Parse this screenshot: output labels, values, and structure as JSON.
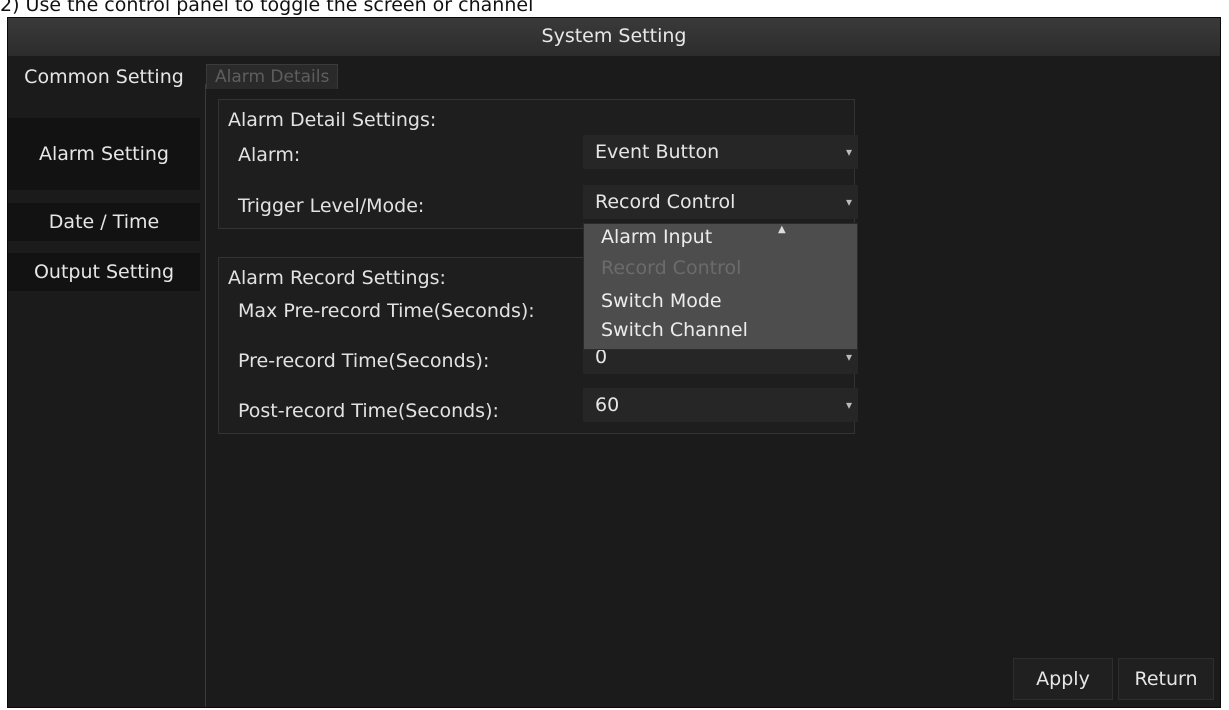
{
  "page_caption": "2) Use the control panel to toggle the screen or channel",
  "window": {
    "title": "System Setting"
  },
  "sidebar": {
    "items": [
      {
        "label": "Common Setting",
        "active": true
      },
      {
        "label": "Alarm Setting"
      },
      {
        "label": "Date / Time"
      },
      {
        "label": "Output Setting"
      }
    ]
  },
  "tab": {
    "label": "Alarm Details"
  },
  "alarm_detail": {
    "section_title": "Alarm Detail Settings:",
    "alarm_label": "Alarm:",
    "alarm_value": "Event Button",
    "trigger_label": "Trigger Level/Mode:",
    "trigger_value": "Record Control"
  },
  "trigger_dropdown": {
    "options": [
      {
        "label": "Alarm Input",
        "enabled": true
      },
      {
        "label": "Record Control",
        "enabled": false
      },
      {
        "label": "Switch Mode",
        "enabled": true
      },
      {
        "label": "Switch Channel",
        "enabled": true
      }
    ]
  },
  "alarm_record": {
    "section_title": "Alarm Record Settings:",
    "max_pre_label": "Max Pre-record Time(Seconds):",
    "pre_label": "Pre-record Time(Seconds):",
    "pre_value": "0",
    "post_label": "Post-record Time(Seconds):",
    "post_value": "60"
  },
  "footer": {
    "apply_label": "Apply",
    "return_label": "Return"
  },
  "colors": {
    "screen_bg": "#1b1b1b",
    "dropdown_bg": "#4d4d4d",
    "disabled_text": "#6b6b6b"
  },
  "icons": {
    "select_arrow": "chevron-down-icon",
    "mouse_pointer": "cursor-icon"
  }
}
